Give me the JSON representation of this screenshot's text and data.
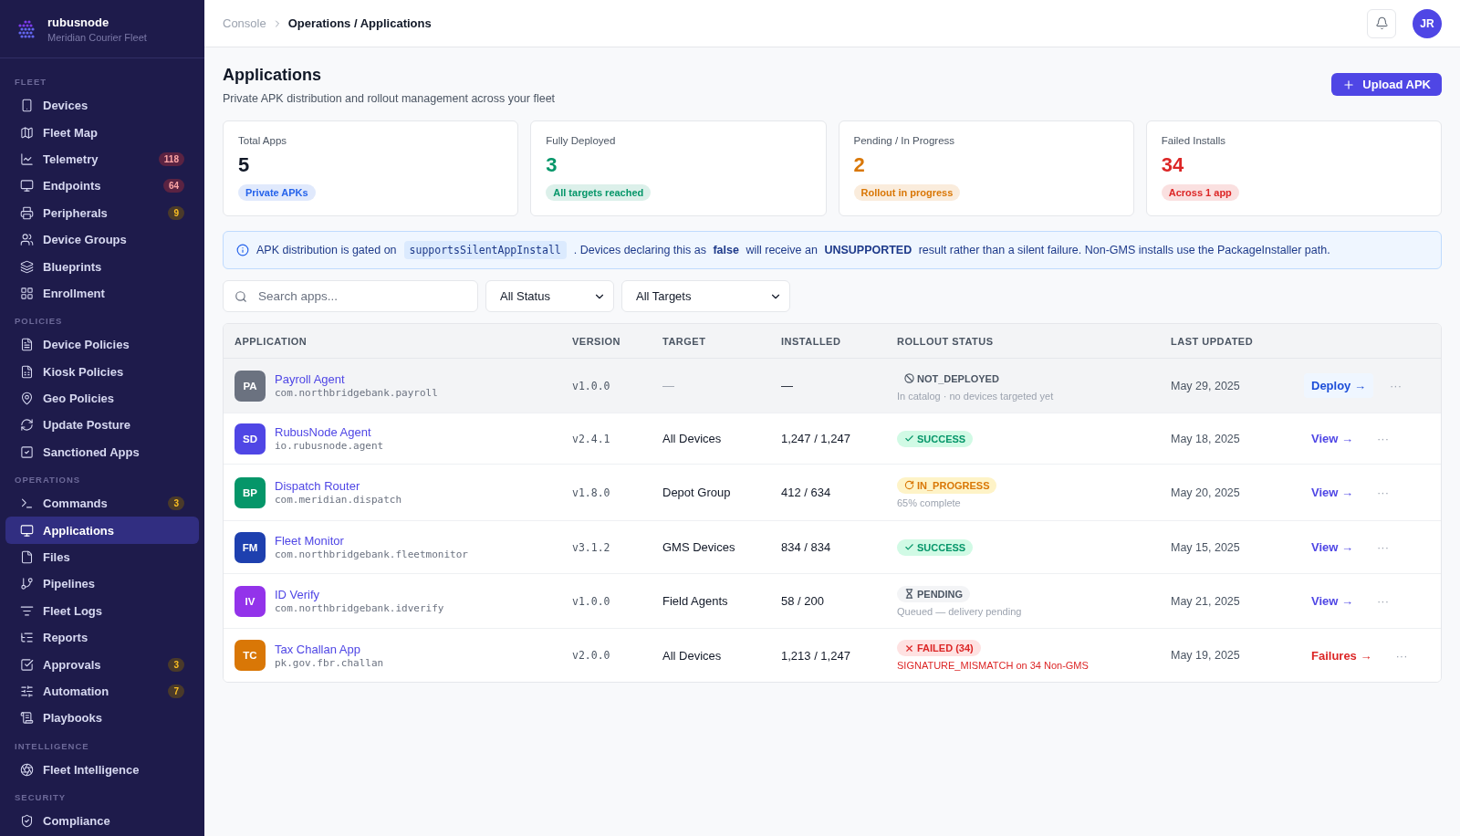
{
  "brand": {
    "name": "rubusnode",
    "subtitle": "Meridian Courier Fleet"
  },
  "sidebar": {
    "sections": [
      {
        "title": "FLEET",
        "items": [
          {
            "label": "Devices",
            "selected": false
          },
          {
            "label": "Fleet Map",
            "selected": false
          },
          {
            "label": "Telemetry",
            "selected": false,
            "badge": "118",
            "color": "#5b2342"
          },
          {
            "label": "Endpoints",
            "selected": false,
            "badge": "64",
            "color": "#5b2342"
          },
          {
            "label": "Peripherals",
            "selected": false,
            "badge": "9",
            "color": "#4a3a2a"
          },
          {
            "label": "Device Groups",
            "selected": false
          },
          {
            "label": "Blueprints",
            "selected": false
          },
          {
            "label": "Enrollment",
            "selected": false
          }
        ]
      },
      {
        "title": "POLICIES",
        "items": [
          {
            "label": "Device Policies",
            "selected": false
          },
          {
            "label": "Kiosk Policies",
            "selected": false
          },
          {
            "label": "Geo Policies",
            "selected": false
          },
          {
            "label": "Update Posture",
            "selected": false
          },
          {
            "label": "Sanctioned Apps",
            "selected": false
          }
        ]
      },
      {
        "title": "OPERATIONS",
        "items": [
          {
            "label": "Commands",
            "selected": false,
            "badge": "3",
            "color": "#4a3a2a"
          },
          {
            "label": "Applications",
            "selected": true
          },
          {
            "label": "Files",
            "selected": false
          },
          {
            "label": "Pipelines",
            "selected": false
          },
          {
            "label": "Fleet Logs",
            "selected": false
          },
          {
            "label": "Reports",
            "selected": false
          },
          {
            "label": "Approvals",
            "selected": false,
            "badge": "3",
            "color": "#4a3a2a"
          },
          {
            "label": "Automation",
            "selected": false,
            "badge": "7",
            "color": "#4a3a2a"
          },
          {
            "label": "Playbooks",
            "selected": false
          }
        ]
      },
      {
        "title": "INTELLIGENCE",
        "items": [
          {
            "label": "Fleet Intelligence",
            "selected": false
          }
        ]
      },
      {
        "title": "SECURITY",
        "items": [
          {
            "label": "Compliance",
            "selected": false
          }
        ]
      }
    ]
  },
  "breadcrumb": [
    "Console",
    "Operations / Applications"
  ],
  "user": {
    "initials": "JR"
  },
  "page": {
    "title": "Applications",
    "subtitle": "Private APK distribution and rollout management across your fleet",
    "primary_action": "Upload APK"
  },
  "stats": [
    {
      "label": "Total Apps",
      "value": "5",
      "tag": "Private APKs",
      "kind": "total",
      "color": "#2563eb"
    },
    {
      "label": "Fully Deployed",
      "value": "3",
      "tag": "All targets reached",
      "kind": "status",
      "color": "#059669"
    },
    {
      "label": "Pending / In Progress",
      "value": "2",
      "tag": "Rollout in progress",
      "kind": "status",
      "color": "#d97706"
    },
    {
      "label": "Failed Installs",
      "value": "34",
      "tag": "Across 1 app",
      "kind": "status",
      "color": "#dc2626"
    }
  ],
  "notice": {
    "lead": "APK distribution is gated on",
    "code": "supportsSilentAppInstall",
    "rest": ". Devices declaring this as **false** will receive an **UNSUPPORTED** result rather than a silent failure. Non-GMS installs use the PackageInstaller path."
  },
  "filters": {
    "search": {
      "placeholder": "Search apps..."
    },
    "status": "All Status",
    "target": "All Targets"
  },
  "table": {
    "columns": [
      "APPLICATION",
      "VERSION",
      "TARGET",
      "INSTALLED",
      "ROLLOUT STATUS",
      "LAST UPDATED"
    ],
    "rows": [
      {
        "initials": "PA",
        "color": "#6b7280",
        "name": "Payroll Agent",
        "package": "com.northbridgebank.payroll",
        "version": "v1.0.0",
        "target": "—",
        "installed": "—",
        "status": {
          "kind": "not_deployed",
          "label": "NOT_DEPLOYED",
          "note": "In catalog · no devices targeted yet"
        },
        "updated": "May 29, 2025",
        "action": {
          "kind": "deploy",
          "label": "Deploy →"
        },
        "menu": "···",
        "selected": true
      },
      {
        "initials": "SD",
        "color": "#4f46e5",
        "name": "RubusNode Agent",
        "package": "io.rubusnode.agent",
        "version": "v2.4.1",
        "target": "All Devices",
        "installed": "1,247 / 1,247",
        "status": {
          "kind": "success",
          "label": "SUCCESS"
        },
        "updated": "May 18, 2025",
        "action": {
          "kind": "view",
          "label": "View →"
        },
        "menu": "···",
        "selected": false
      },
      {
        "initials": "BP",
        "color": "#059669",
        "name": "Dispatch Router",
        "package": "com.meridian.dispatch",
        "version": "v1.8.0",
        "target": "Depot Group",
        "installed": "412 / 634",
        "status": {
          "kind": "in_progress",
          "label": "IN_PROGRESS",
          "note": "65% complete"
        },
        "updated": "May 20, 2025",
        "action": {
          "kind": "view",
          "label": "View →"
        },
        "menu": "···",
        "selected": false
      },
      {
        "initials": "FM",
        "color": "#1e40af",
        "name": "Fleet Monitor",
        "package": "com.northbridgebank.fleetmonitor",
        "version": "v3.1.2",
        "target": "GMS Devices",
        "installed": "834 / 834",
        "status": {
          "kind": "success",
          "label": "SUCCESS"
        },
        "updated": "May 15, 2025",
        "action": {
          "kind": "view",
          "label": "View →"
        },
        "menu": "···",
        "selected": false
      },
      {
        "initials": "IV",
        "color": "#9333ea",
        "name": "ID Verify",
        "package": "com.northbridgebank.idverify",
        "version": "v1.0.0",
        "target": "Field Agents",
        "installed": "58 / 200",
        "status": {
          "kind": "pending",
          "label": "PENDING",
          "note": "Queued — delivery pending"
        },
        "updated": "May 21, 2025",
        "action": {
          "kind": "view",
          "label": "View →"
        },
        "menu": "···",
        "selected": false
      },
      {
        "initials": "TC",
        "color": "#d97706",
        "name": "Tax Challan App",
        "package": "pk.gov.fbr.challan",
        "version": "v2.0.0",
        "target": "All Devices",
        "installed": "1,213 / 1,247",
        "status": {
          "kind": "failed",
          "label": "FAILED (34)",
          "note": "SIGNATURE_MISMATCH on 34 Non-GMS"
        },
        "updated": "May 19, 2025",
        "action": {
          "kind": "failures",
          "label": "Failures →"
        },
        "menu": "···",
        "selected": false
      }
    ]
  }
}
